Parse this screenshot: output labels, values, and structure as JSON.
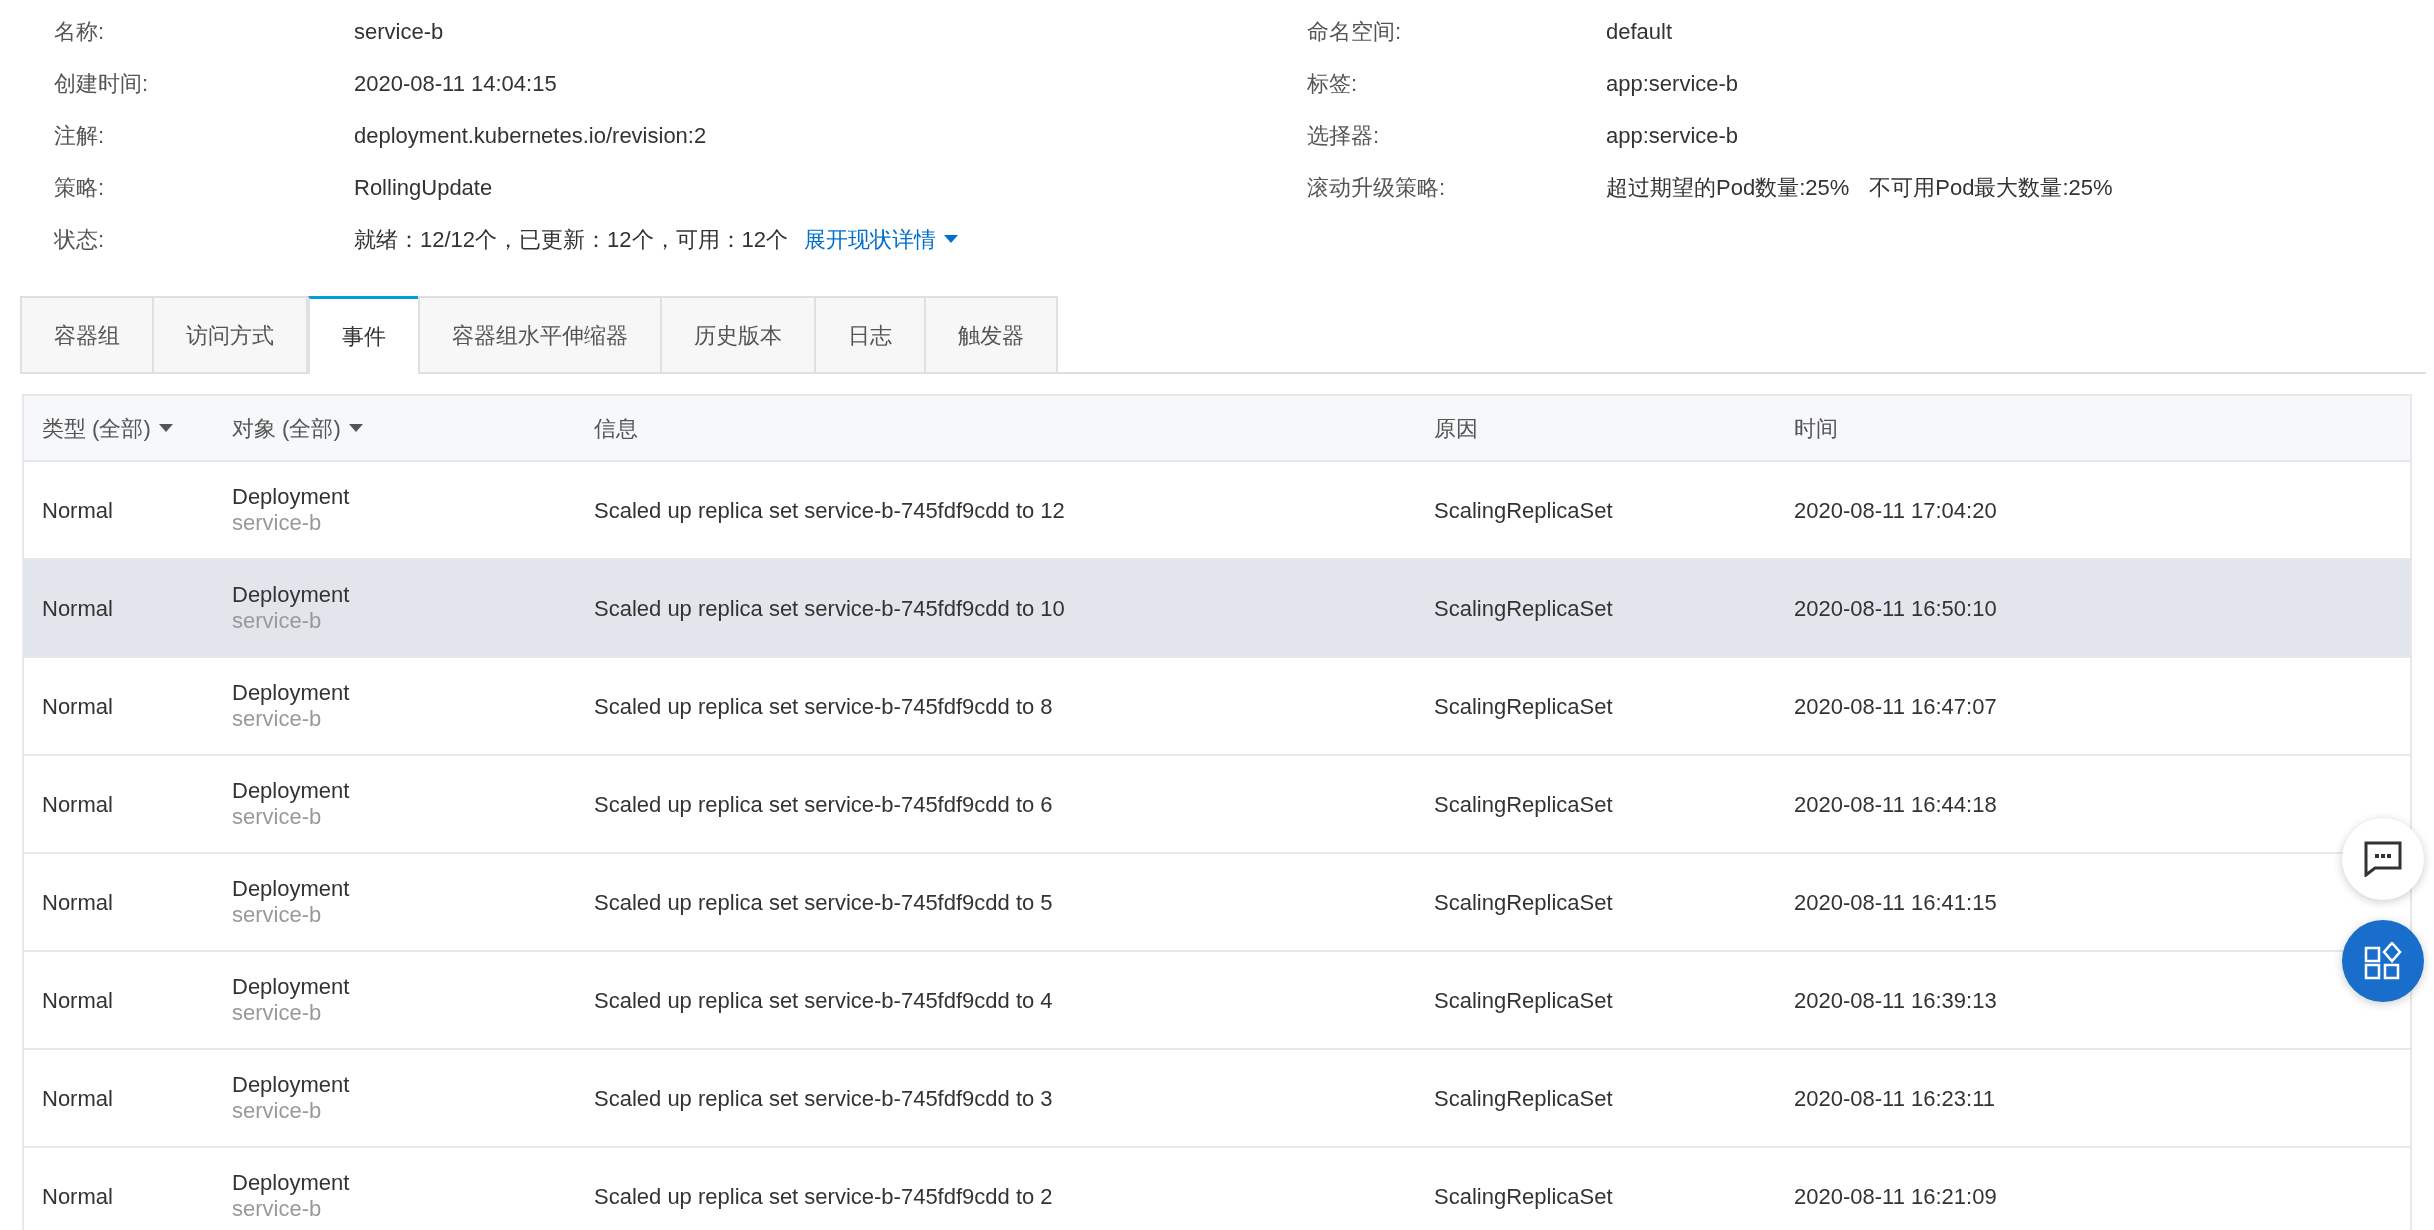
{
  "details_left": [
    {
      "label": "名称:",
      "value": "service-b"
    },
    {
      "label": "创建时间:",
      "value": "2020-08-11 14:04:15"
    },
    {
      "label": "注解:",
      "value": "deployment.kubernetes.io/revision:2"
    },
    {
      "label": "策略:",
      "value": "RollingUpdate"
    },
    {
      "label": "状态:",
      "value": "就绪：12/12个，已更新：12个，可用：12个",
      "link": "展开现状详情"
    }
  ],
  "details_right": [
    {
      "label": "命名空间:",
      "value": "default"
    },
    {
      "label": "标签:",
      "value": "app:service-b"
    },
    {
      "label": "选择器:",
      "value": "app:service-b"
    },
    {
      "label": "滚动升级策略:",
      "value": "超过期望的Pod数量:25%",
      "value_2": "不可用Pod最大数量:25%"
    }
  ],
  "tabs": [
    {
      "label": "容器组",
      "selected": false
    },
    {
      "label": "访问方式",
      "selected": false
    },
    {
      "label": "事件",
      "selected": true
    },
    {
      "label": "容器组水平伸缩器",
      "selected": false
    },
    {
      "label": "历史版本",
      "selected": false
    },
    {
      "label": "日志",
      "selected": false
    },
    {
      "label": "触发器",
      "selected": false
    }
  ],
  "table": {
    "columns": [
      {
        "label": "类型 (全部)",
        "filter": true
      },
      {
        "label": "对象 (全部)",
        "filter": true
      },
      {
        "label": "信息",
        "filter": false
      },
      {
        "label": "原因",
        "filter": false
      },
      {
        "label": "时间",
        "filter": false
      }
    ],
    "rows": [
      {
        "type": "Normal",
        "object": "Deployment",
        "object_name": "service-b",
        "message": "Scaled up replica set service-b-745fdf9cdd to 12",
        "reason": "ScalingReplicaSet",
        "time": "2020-08-11 17:04:20",
        "highlighted": false
      },
      {
        "type": "Normal",
        "object": "Deployment",
        "object_name": "service-b",
        "message": "Scaled up replica set service-b-745fdf9cdd to 10",
        "reason": "ScalingReplicaSet",
        "time": "2020-08-11 16:50:10",
        "highlighted": true
      },
      {
        "type": "Normal",
        "object": "Deployment",
        "object_name": "service-b",
        "message": "Scaled up replica set service-b-745fdf9cdd to 8",
        "reason": "ScalingReplicaSet",
        "time": "2020-08-11 16:47:07",
        "highlighted": false
      },
      {
        "type": "Normal",
        "object": "Deployment",
        "object_name": "service-b",
        "message": "Scaled up replica set service-b-745fdf9cdd to 6",
        "reason": "ScalingReplicaSet",
        "time": "2020-08-11 16:44:18",
        "highlighted": false
      },
      {
        "type": "Normal",
        "object": "Deployment",
        "object_name": "service-b",
        "message": "Scaled up replica set service-b-745fdf9cdd to 5",
        "reason": "ScalingReplicaSet",
        "time": "2020-08-11 16:41:15",
        "highlighted": false
      },
      {
        "type": "Normal",
        "object": "Deployment",
        "object_name": "service-b",
        "message": "Scaled up replica set service-b-745fdf9cdd to 4",
        "reason": "ScalingReplicaSet",
        "time": "2020-08-11 16:39:13",
        "highlighted": false
      },
      {
        "type": "Normal",
        "object": "Deployment",
        "object_name": "service-b",
        "message": "Scaled up replica set service-b-745fdf9cdd to 3",
        "reason": "ScalingReplicaSet",
        "time": "2020-08-11 16:23:11",
        "highlighted": false
      },
      {
        "type": "Normal",
        "object": "Deployment",
        "object_name": "service-b",
        "message": "Scaled up replica set service-b-745fdf9cdd to 2",
        "reason": "ScalingReplicaSet",
        "time": "2020-08-11 16:21:09",
        "highlighted": false
      }
    ]
  }
}
